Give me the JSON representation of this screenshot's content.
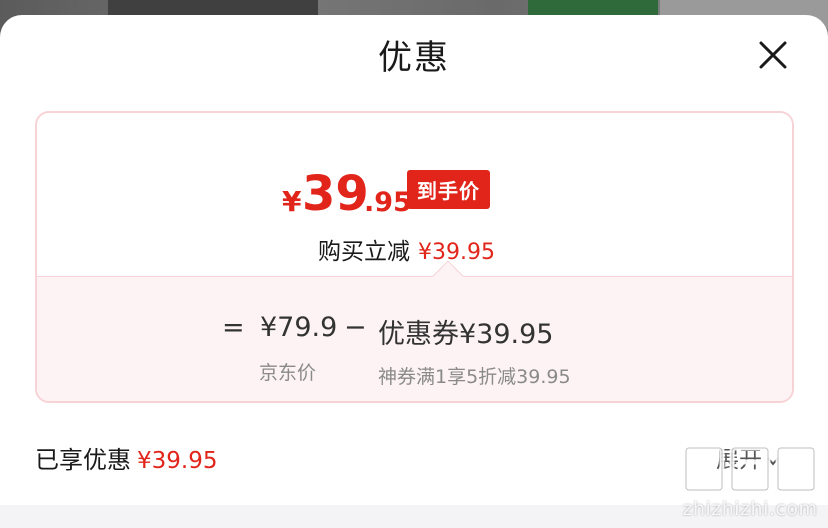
{
  "sheet": {
    "title": "优惠",
    "close_icon": "close-icon"
  },
  "price_card": {
    "final_price": {
      "currency": "¥",
      "integer": "39",
      "decimal": ".95"
    },
    "final_price_tag": "到手价",
    "instant_discount_label": "购买立减",
    "instant_discount_amount": "¥39.95",
    "formula": {
      "equals": "=",
      "base_price": "¥79.9",
      "minus": "−",
      "coupon": "优惠券¥39.95"
    },
    "base_price_caption": "京东价",
    "coupon_caption": "神券满1享5折减39.95"
  },
  "summary": {
    "label": "已享优惠",
    "amount": "¥39.95",
    "expand_label": "展开",
    "expand_icon": "chevron-down-icon"
  },
  "watermark": {
    "logo_name": "zhizhizhi-logo",
    "text": "zhizhizhi.com"
  },
  "colors": {
    "accent_red": "#e1251b",
    "card_border": "#f7d3d6",
    "card_bottom_bg": "#fdf3f4"
  }
}
